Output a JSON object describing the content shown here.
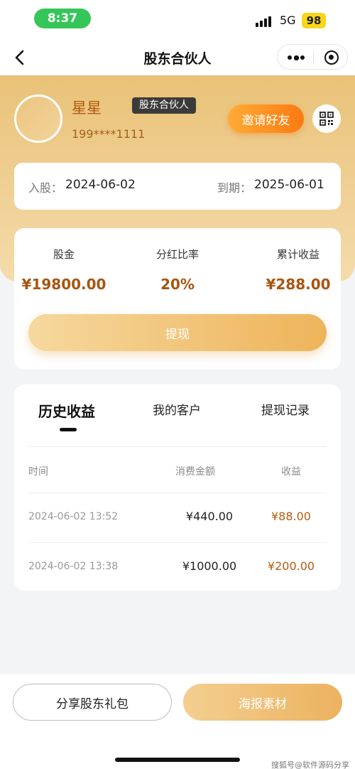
{
  "status_bar": {
    "time": "8:37",
    "network": "5G",
    "battery": "98"
  },
  "nav": {
    "title": "股东合伙人"
  },
  "profile": {
    "name": "星星",
    "badge": "股东合伙人",
    "phone": "199****1111",
    "invite_label": "邀请好友"
  },
  "dates": {
    "join_label": "入股：",
    "join_value": "2024-06-02",
    "expire_label": "到期：",
    "expire_value": "2025-06-01"
  },
  "stats": [
    {
      "label": "股金",
      "value": "¥19800.00"
    },
    {
      "label": "分红比率",
      "value": "20%"
    },
    {
      "label": "累计收益",
      "value": "¥288.00"
    }
  ],
  "withdraw_label": "提现",
  "tabs": [
    {
      "label": "历史收益",
      "active": true
    },
    {
      "label": "我的客户",
      "active": false
    },
    {
      "label": "提现记录",
      "active": false
    }
  ],
  "table": {
    "headers": [
      "时间",
      "消费金额",
      "收益"
    ],
    "rows": [
      {
        "time": "2024-06-02 13:52",
        "amount": "¥440.00",
        "earning": "¥88.00"
      },
      {
        "time": "2024-06-02 13:38",
        "amount": "¥1000.00",
        "earning": "¥200.00"
      }
    ]
  },
  "bottom": {
    "share_label": "分享股东礼包",
    "poster_label": "海报素材"
  },
  "watermark": "搜狐号@软件源码分享",
  "colors": {
    "accent": "#fb7a12",
    "gold": "#e9c277",
    "earning": "#a85510"
  }
}
